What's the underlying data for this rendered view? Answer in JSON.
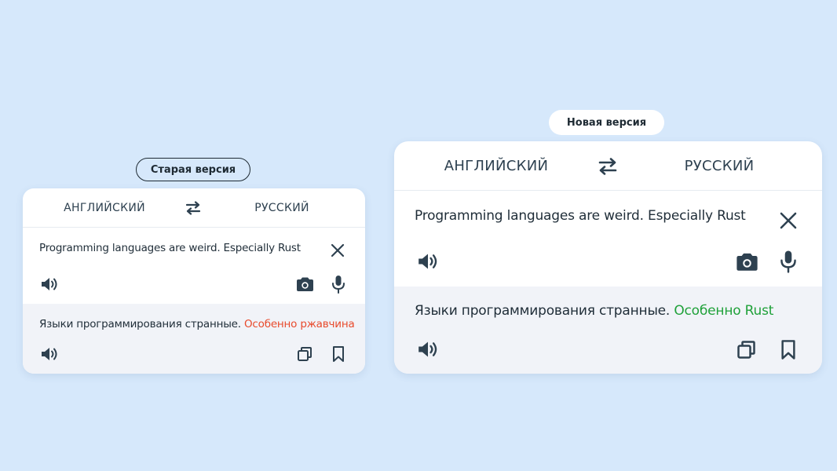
{
  "old_version": {
    "label": "Старая версия",
    "source_lang": "АНГЛИЙСКИЙ",
    "target_lang": "РУССКИЙ",
    "source_text": "Programming languages are weird. Especially Rust",
    "translation_main": "Языки программирования странные.",
    "translation_accent": "Особенно ржавчина",
    "accent_color": "#e84a2c"
  },
  "new_version": {
    "label": "Новая версия",
    "source_lang": "АНГЛИЙСКИЙ",
    "target_lang": "РУССКИЙ",
    "source_text": "Programming languages are weird. Especially Rust",
    "translation_main": "Языки программирования странные.",
    "translation_accent": "Особенно Rust",
    "accent_color": "#20a13a"
  },
  "icons": [
    "swap-icon",
    "speaker-icon",
    "clear-icon",
    "camera-icon",
    "microphone-icon",
    "copy-icon",
    "bookmark-icon"
  ],
  "colors": {
    "background": "#d6e8fb",
    "card": "#ffffff",
    "translation_bg": "#f1f3f8",
    "icon": "#2e4150"
  }
}
